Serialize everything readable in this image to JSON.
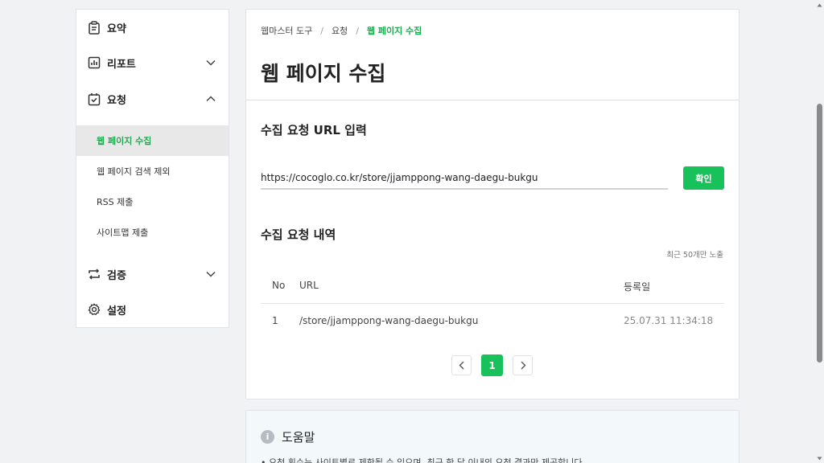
{
  "sidebar": {
    "items": [
      {
        "label": "요약",
        "icon": "clipboard-icon"
      },
      {
        "label": "리포트",
        "icon": "bar-chart-icon",
        "expanded": false
      },
      {
        "label": "요청",
        "icon": "checkbox-icon",
        "expanded": true
      },
      {
        "label": "검증",
        "icon": "repeat-icon",
        "expanded": false
      },
      {
        "label": "설정",
        "icon": "gear-icon"
      }
    ],
    "subitems": [
      {
        "label": "웹 페이지 수집",
        "active": true
      },
      {
        "label": "웹 페이지 검색 제외"
      },
      {
        "label": "RSS 제출"
      },
      {
        "label": "사이트맵 제출"
      }
    ]
  },
  "breadcrumb": [
    "웹마스터 도구",
    "요청",
    "웹 페이지 수집"
  ],
  "page_title": "웹 페이지 수집",
  "request_section": {
    "title": "수집 요청 URL 입력",
    "url_value": "https://cocoglo.co.kr/store/jjamppong-wang-daegu-bukgu",
    "confirm_label": "확인"
  },
  "history_section": {
    "title": "수집 요청 내역",
    "note": "최근 50개만 노출",
    "columns": [
      "No",
      "URL",
      "등록일"
    ],
    "rows": [
      {
        "no": "1",
        "url": "/store/jjamppong-wang-daegu-bukgu",
        "date": "25.07.31 11:34:18"
      }
    ]
  },
  "pagination": {
    "current": "1"
  },
  "help": {
    "title": "도움말",
    "text": "• 요청 횟수는 사이트별로 제한될 수 있으며, 최근 한 달 이내의 요청 결과만 제공합니다."
  },
  "colors": {
    "accent": "#19c15a",
    "accent_text": "#1faa50"
  }
}
